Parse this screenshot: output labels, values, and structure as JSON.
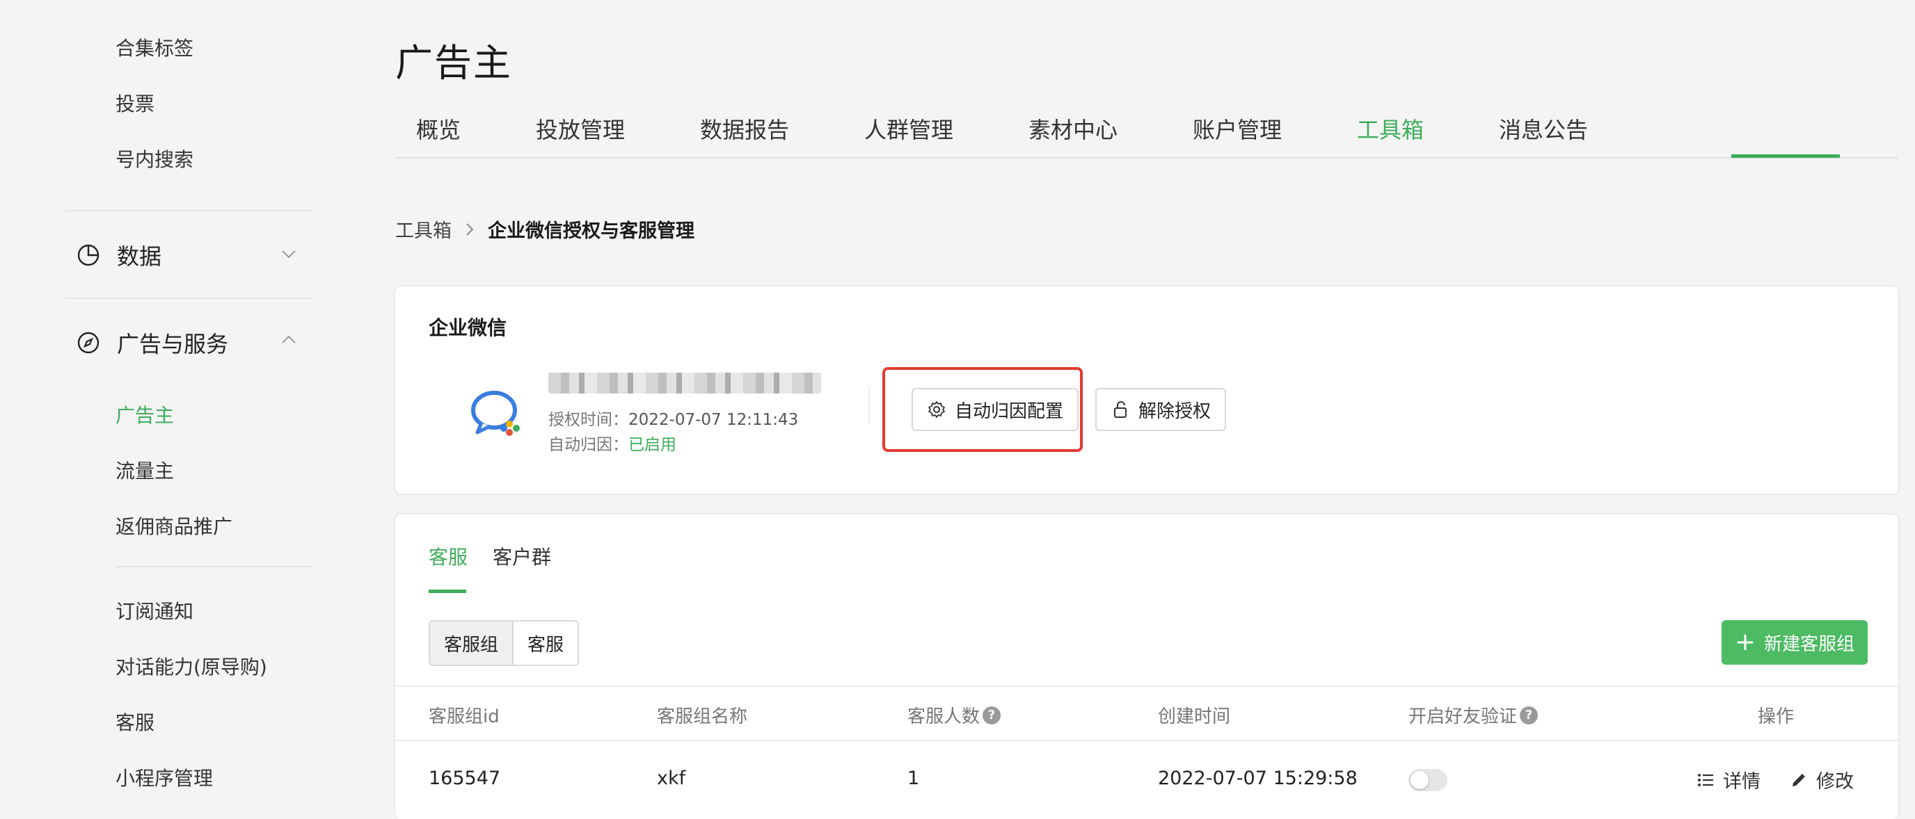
{
  "sidebar": {
    "top_items": [
      "合集标签",
      "投票",
      "号内搜索"
    ],
    "group_data": {
      "label": "数据",
      "icon": "pie-chart-icon"
    },
    "group_ads": {
      "label": "广告与服务",
      "icon": "compass-icon"
    },
    "ads_items": [
      "广告主",
      "流量主",
      "返佣商品推广"
    ],
    "bottom_items": [
      "订阅通知",
      "对话能力(原导购)",
      "客服",
      "小程序管理"
    ]
  },
  "page": {
    "title": "广告主",
    "tabs": [
      "概览",
      "投放管理",
      "数据报告",
      "人群管理",
      "素材中心",
      "账户管理",
      "工具箱",
      "消息公告"
    ],
    "active_tab": "工具箱"
  },
  "breadcrumb": {
    "parent": "工具箱",
    "current": "企业微信授权与客服管理"
  },
  "wecom": {
    "title": "企业微信",
    "auth_time_label": "授权时间：",
    "auth_time": "2022-07-07 12:11:43",
    "auto_attr_label": "自动归因：",
    "auto_attr_status": "已启用",
    "config_button": "自动归因配置",
    "revoke_button": "解除授权"
  },
  "service": {
    "tabs": [
      "客服",
      "客户群"
    ],
    "segments": [
      "客服组",
      "客服"
    ],
    "new_button": "新建客服组",
    "columns": [
      "客服组id",
      "客服组名称",
      "客服人数",
      "创建时间",
      "开启好友验证",
      "操作"
    ],
    "rows": [
      {
        "id": "165547",
        "name": "xkf",
        "count": "1",
        "created": "2022-07-07 15:29:58",
        "verify": false
      }
    ],
    "actions": {
      "detail": "详情",
      "edit": "修改"
    }
  },
  "colors": {
    "accent": "#3ead5a",
    "highlight": "#e03b30",
    "primary_button": "#4cbb63"
  }
}
